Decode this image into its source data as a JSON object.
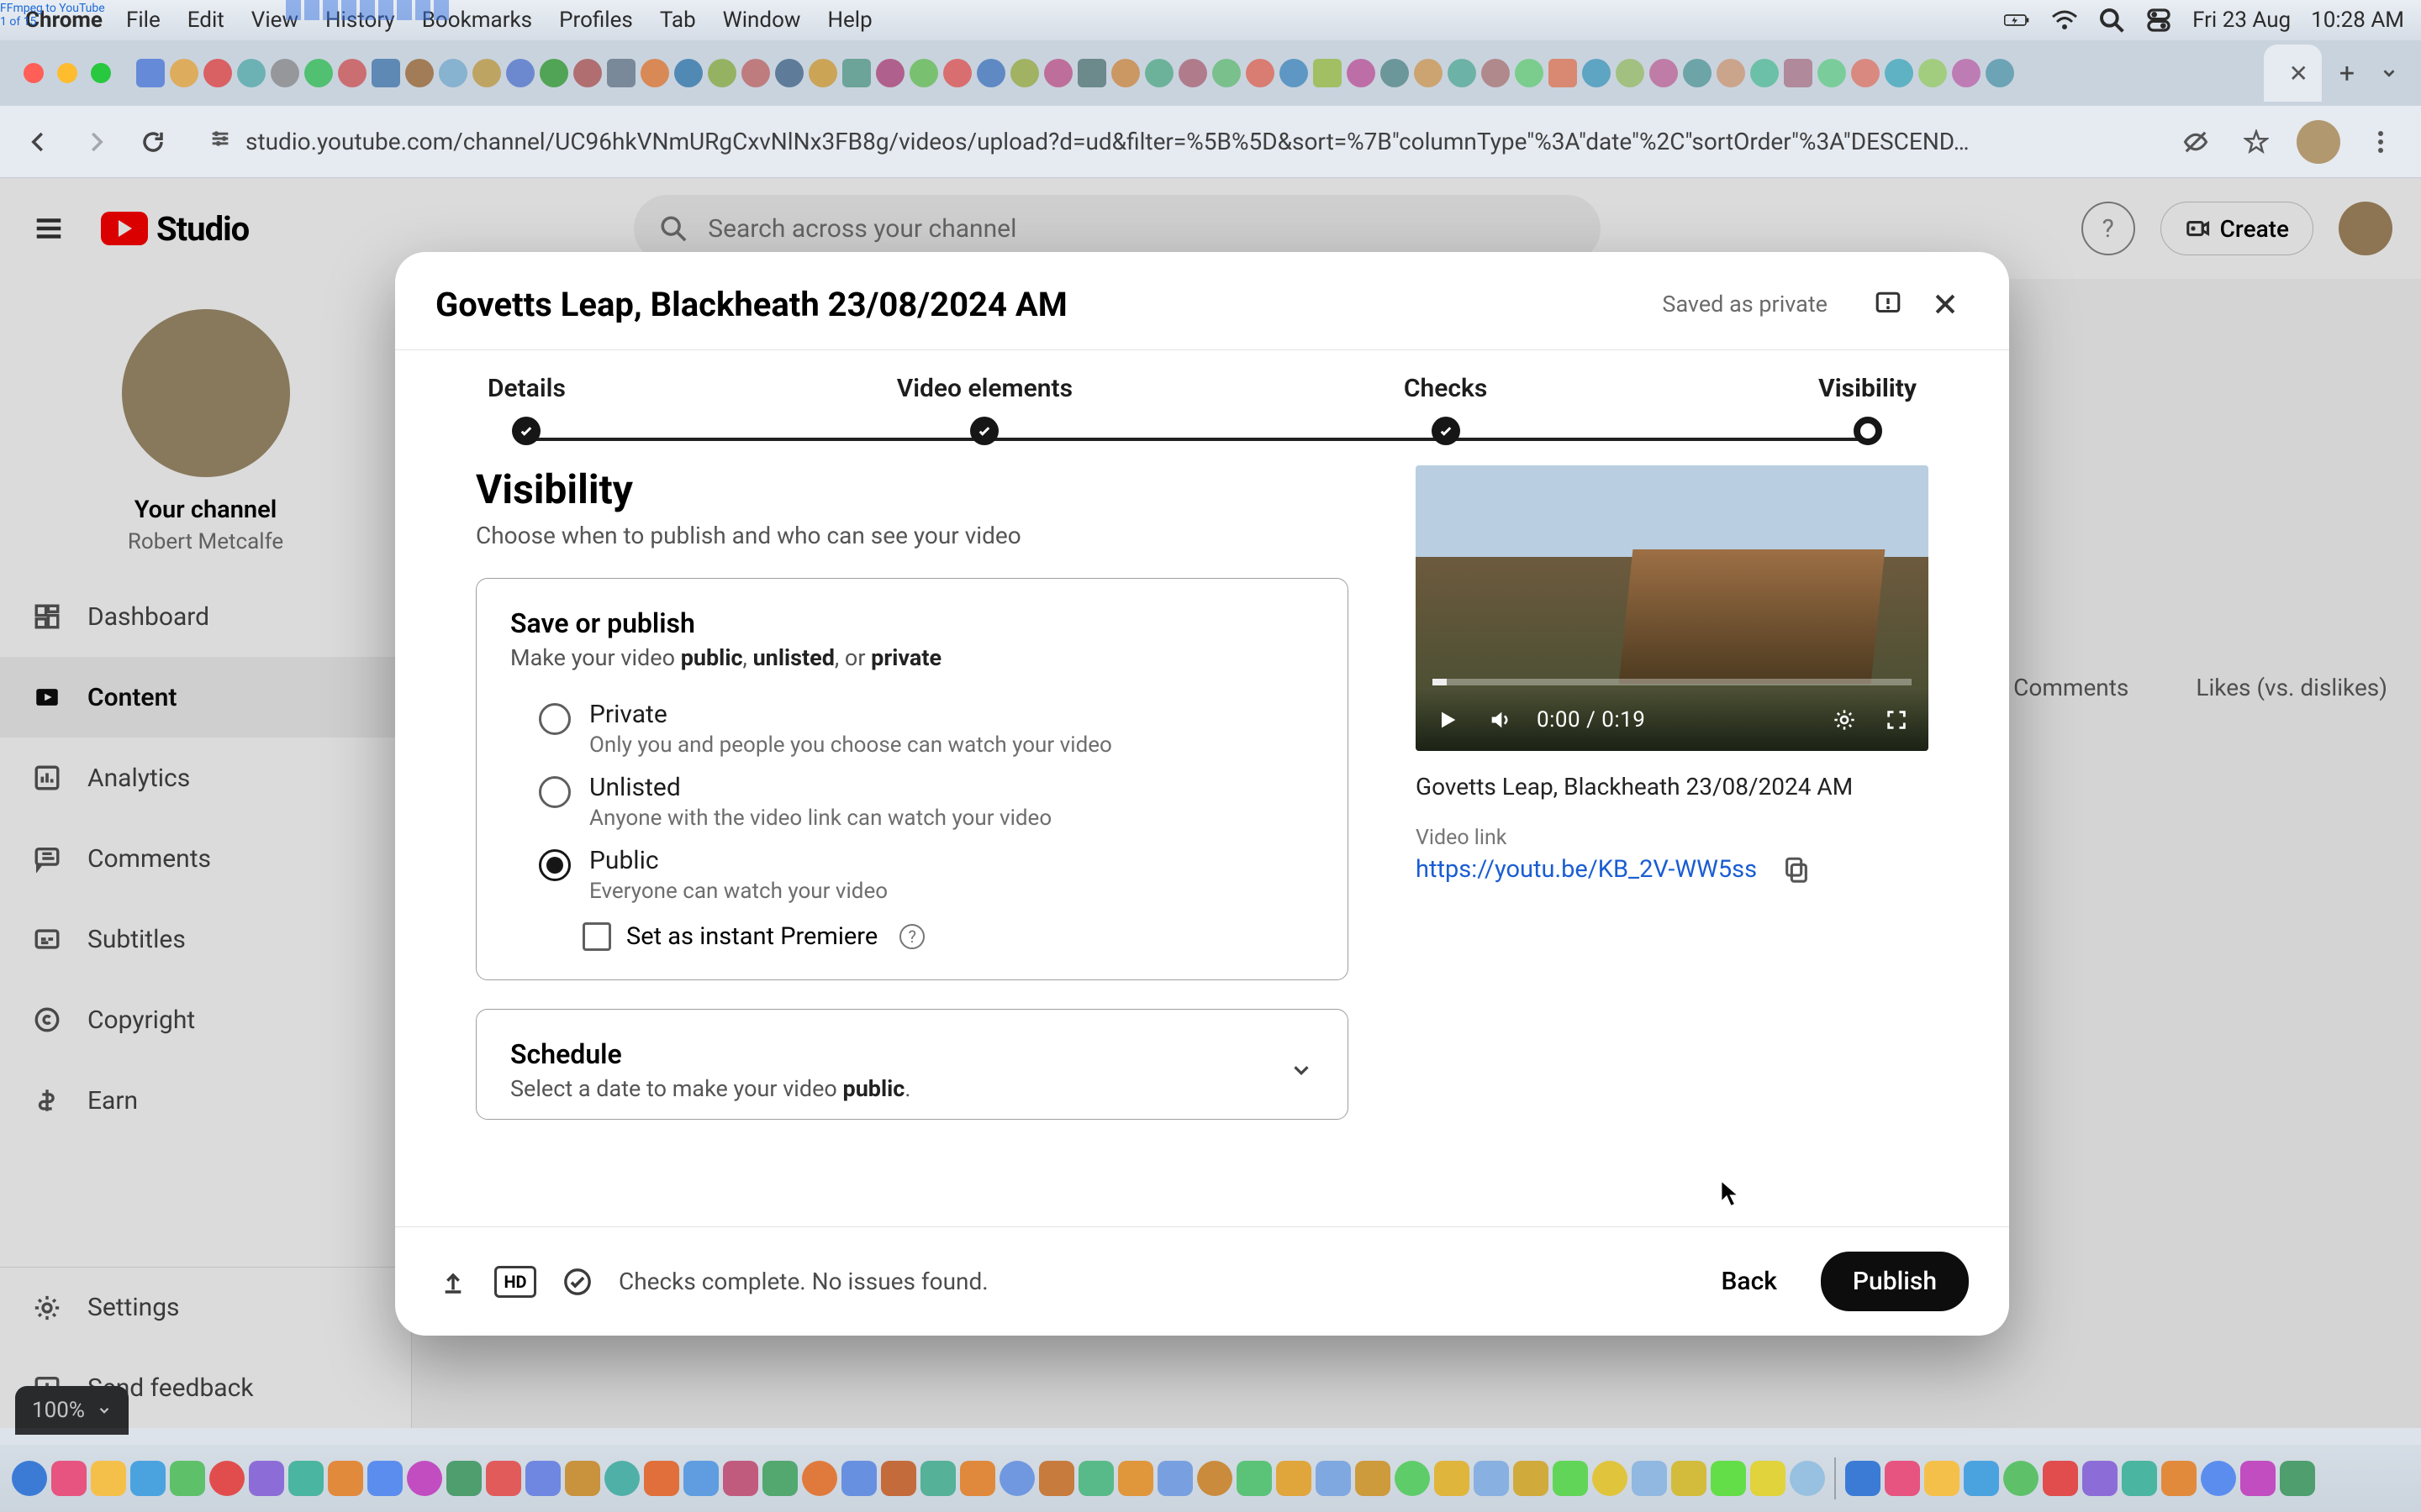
{
  "mac": {
    "app": "Chrome",
    "menu": [
      "File",
      "Edit",
      "View",
      "History",
      "Bookmarks",
      "Profiles",
      "Tab",
      "Window",
      "Help"
    ],
    "clock_day": "Fri 23 Aug",
    "clock_time": "10:28 AM",
    "overlay_title": "FFmpeg to YouTube\n1 of 15"
  },
  "browser": {
    "url": "studio.youtube.com/channel/UC96hkVNmURgCxvNlNx3FB8g/videos/upload?d=ud&filter=%5B%5D&sort=%7B\"columnType\"%3A\"date\"%2C\"sortOrder\"%3A\"DESCEND…"
  },
  "studio": {
    "logo_text": "Studio",
    "search_placeholder": "Search across your channel",
    "create_label": "Create",
    "channel": {
      "your_channel": "Your channel",
      "name": "Robert Metcalfe"
    },
    "nav": [
      {
        "label": "Dashboard",
        "icon": "dashboard"
      },
      {
        "label": "Content",
        "icon": "content",
        "active": true
      },
      {
        "label": "Analytics",
        "icon": "analytics"
      },
      {
        "label": "Comments",
        "icon": "comments"
      },
      {
        "label": "Subtitles",
        "icon": "subtitles"
      },
      {
        "label": "Copyright",
        "icon": "copyright"
      },
      {
        "label": "Earn",
        "icon": "earn"
      }
    ],
    "bottom_nav": [
      {
        "label": "Settings",
        "icon": "settings"
      },
      {
        "label": "Send feedback",
        "icon": "feedback"
      }
    ],
    "content_columns": [
      "Comments",
      "Likes (vs. dislikes)"
    ],
    "zoom_label": "100%"
  },
  "modal": {
    "title": "Govetts Leap, Blackheath 23/08/2024 AM",
    "saved_text": "Saved as private",
    "steps": [
      "Details",
      "Video elements",
      "Checks",
      "Visibility"
    ],
    "section": {
      "heading": "Visibility",
      "sub": "Choose when to publish and who can see your video"
    },
    "save_card": {
      "title": "Save or publish",
      "help_prefix": "Make your video ",
      "bold1": "public",
      "sep1": ", ",
      "bold2": "unlisted",
      "sep2": ", or ",
      "bold3": "private",
      "options": [
        {
          "label": "Private",
          "desc": "Only you and people you choose can watch your video",
          "value": "private"
        },
        {
          "label": "Unlisted",
          "desc": "Anyone with the video link can watch your video",
          "value": "unlisted"
        },
        {
          "label": "Public",
          "desc": "Everyone can watch your video",
          "value": "public",
          "selected": true
        }
      ],
      "premiere_label": "Set as instant Premiere"
    },
    "schedule_card": {
      "title": "Schedule",
      "help_prefix": "Select a date to make your video ",
      "bold": "public",
      "suffix": "."
    },
    "player": {
      "time": "0:00 / 0:19"
    },
    "video_title": "Govetts Leap, Blackheath 23/08/2024 AM",
    "link_label": "Video link",
    "link_url": "https://youtu.be/KB_2V-WW5ss",
    "footer": {
      "hd": "HD",
      "checks_text": "Checks complete. No issues found.",
      "back": "Back",
      "publish": "Publish"
    }
  }
}
